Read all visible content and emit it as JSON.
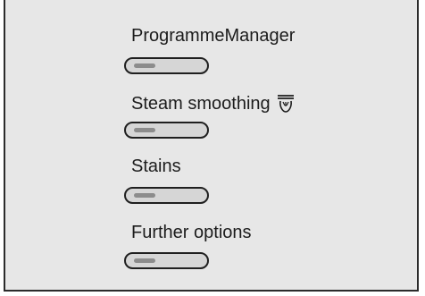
{
  "options": [
    {
      "label": "ProgrammeManager",
      "toggle_on": false
    },
    {
      "label": "Steam smoothing",
      "icon": "steam-iron-icon",
      "toggle_on": false
    },
    {
      "label": "Stains",
      "toggle_on": false
    },
    {
      "label": "Further options",
      "toggle_on": false
    }
  ],
  "colors": {
    "panel_background": "#e7e7e7",
    "border": "#2b2b2b",
    "toggle_track": "#d6d6d6",
    "toggle_knob": "#8c8c8c",
    "text": "#1c1c1c"
  }
}
